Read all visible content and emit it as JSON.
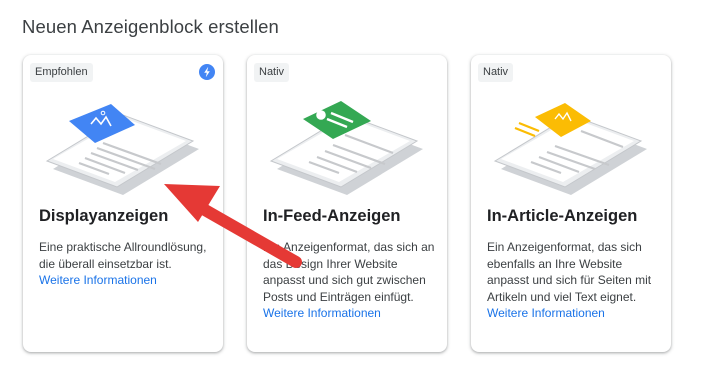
{
  "page": {
    "title": "Neuen Anzeigenblock erstellen"
  },
  "cards": [
    {
      "badge": "Empfohlen",
      "badge_icon": "bolt-icon",
      "title": "Displayanzeigen",
      "description": "Eine praktische Allroundlösung, die überall einsetzbar ist.",
      "link": "Weitere Informationen",
      "accent_color": "#4285f4"
    },
    {
      "badge": "Nativ",
      "title": "In-Feed-Anzeigen",
      "description": "Ein Anzeigenformat, das sich an das Design Ihrer Website anpasst und sich gut zwischen Posts und Einträgen einfügt.",
      "link": "Weitere Informationen",
      "accent_color": "#34a853"
    },
    {
      "badge": "Nativ",
      "title": "In-Article-Anzeigen",
      "description": "Ein Anzeigenformat, das sich ebenfalls an Ihre Website anpasst und sich für Seiten mit Artikeln und viel Text eignet.",
      "link": "Weitere Informationen",
      "accent_color": "#fbbc04"
    }
  ],
  "colors": {
    "link": "#1a73e8",
    "annotation_arrow": "#e53935"
  }
}
